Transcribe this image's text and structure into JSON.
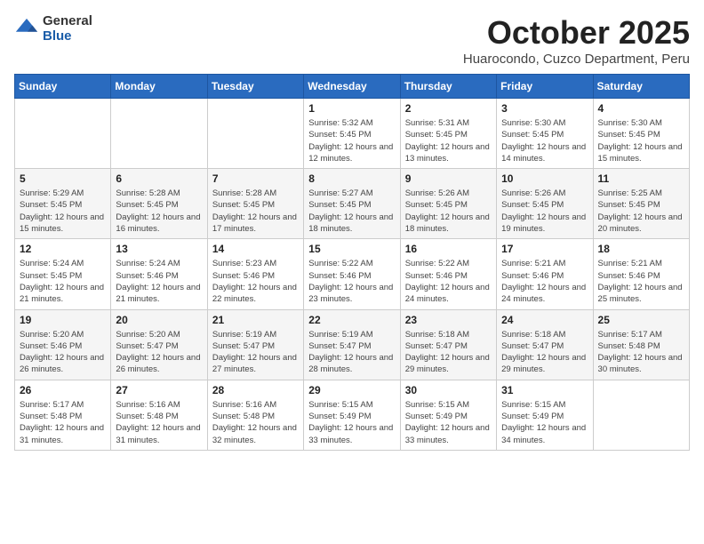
{
  "logo": {
    "general": "General",
    "blue": "Blue"
  },
  "title": "October 2025",
  "location": "Huarocondo, Cuzco Department, Peru",
  "days_of_week": [
    "Sunday",
    "Monday",
    "Tuesday",
    "Wednesday",
    "Thursday",
    "Friday",
    "Saturday"
  ],
  "weeks": [
    [
      {
        "day": "",
        "sunrise": "",
        "sunset": "",
        "daylight": ""
      },
      {
        "day": "",
        "sunrise": "",
        "sunset": "",
        "daylight": ""
      },
      {
        "day": "",
        "sunrise": "",
        "sunset": "",
        "daylight": ""
      },
      {
        "day": "1",
        "sunrise": "Sunrise: 5:32 AM",
        "sunset": "Sunset: 5:45 PM",
        "daylight": "Daylight: 12 hours and 12 minutes."
      },
      {
        "day": "2",
        "sunrise": "Sunrise: 5:31 AM",
        "sunset": "Sunset: 5:45 PM",
        "daylight": "Daylight: 12 hours and 13 minutes."
      },
      {
        "day": "3",
        "sunrise": "Sunrise: 5:30 AM",
        "sunset": "Sunset: 5:45 PM",
        "daylight": "Daylight: 12 hours and 14 minutes."
      },
      {
        "day": "4",
        "sunrise": "Sunrise: 5:30 AM",
        "sunset": "Sunset: 5:45 PM",
        "daylight": "Daylight: 12 hours and 15 minutes."
      }
    ],
    [
      {
        "day": "5",
        "sunrise": "Sunrise: 5:29 AM",
        "sunset": "Sunset: 5:45 PM",
        "daylight": "Daylight: 12 hours and 15 minutes."
      },
      {
        "day": "6",
        "sunrise": "Sunrise: 5:28 AM",
        "sunset": "Sunset: 5:45 PM",
        "daylight": "Daylight: 12 hours and 16 minutes."
      },
      {
        "day": "7",
        "sunrise": "Sunrise: 5:28 AM",
        "sunset": "Sunset: 5:45 PM",
        "daylight": "Daylight: 12 hours and 17 minutes."
      },
      {
        "day": "8",
        "sunrise": "Sunrise: 5:27 AM",
        "sunset": "Sunset: 5:45 PM",
        "daylight": "Daylight: 12 hours and 18 minutes."
      },
      {
        "day": "9",
        "sunrise": "Sunrise: 5:26 AM",
        "sunset": "Sunset: 5:45 PM",
        "daylight": "Daylight: 12 hours and 18 minutes."
      },
      {
        "day": "10",
        "sunrise": "Sunrise: 5:26 AM",
        "sunset": "Sunset: 5:45 PM",
        "daylight": "Daylight: 12 hours and 19 minutes."
      },
      {
        "day": "11",
        "sunrise": "Sunrise: 5:25 AM",
        "sunset": "Sunset: 5:45 PM",
        "daylight": "Daylight: 12 hours and 20 minutes."
      }
    ],
    [
      {
        "day": "12",
        "sunrise": "Sunrise: 5:24 AM",
        "sunset": "Sunset: 5:45 PM",
        "daylight": "Daylight: 12 hours and 21 minutes."
      },
      {
        "day": "13",
        "sunrise": "Sunrise: 5:24 AM",
        "sunset": "Sunset: 5:46 PM",
        "daylight": "Daylight: 12 hours and 21 minutes."
      },
      {
        "day": "14",
        "sunrise": "Sunrise: 5:23 AM",
        "sunset": "Sunset: 5:46 PM",
        "daylight": "Daylight: 12 hours and 22 minutes."
      },
      {
        "day": "15",
        "sunrise": "Sunrise: 5:22 AM",
        "sunset": "Sunset: 5:46 PM",
        "daylight": "Daylight: 12 hours and 23 minutes."
      },
      {
        "day": "16",
        "sunrise": "Sunrise: 5:22 AM",
        "sunset": "Sunset: 5:46 PM",
        "daylight": "Daylight: 12 hours and 24 minutes."
      },
      {
        "day": "17",
        "sunrise": "Sunrise: 5:21 AM",
        "sunset": "Sunset: 5:46 PM",
        "daylight": "Daylight: 12 hours and 24 minutes."
      },
      {
        "day": "18",
        "sunrise": "Sunrise: 5:21 AM",
        "sunset": "Sunset: 5:46 PM",
        "daylight": "Daylight: 12 hours and 25 minutes."
      }
    ],
    [
      {
        "day": "19",
        "sunrise": "Sunrise: 5:20 AM",
        "sunset": "Sunset: 5:46 PM",
        "daylight": "Daylight: 12 hours and 26 minutes."
      },
      {
        "day": "20",
        "sunrise": "Sunrise: 5:20 AM",
        "sunset": "Sunset: 5:47 PM",
        "daylight": "Daylight: 12 hours and 26 minutes."
      },
      {
        "day": "21",
        "sunrise": "Sunrise: 5:19 AM",
        "sunset": "Sunset: 5:47 PM",
        "daylight": "Daylight: 12 hours and 27 minutes."
      },
      {
        "day": "22",
        "sunrise": "Sunrise: 5:19 AM",
        "sunset": "Sunset: 5:47 PM",
        "daylight": "Daylight: 12 hours and 28 minutes."
      },
      {
        "day": "23",
        "sunrise": "Sunrise: 5:18 AM",
        "sunset": "Sunset: 5:47 PM",
        "daylight": "Daylight: 12 hours and 29 minutes."
      },
      {
        "day": "24",
        "sunrise": "Sunrise: 5:18 AM",
        "sunset": "Sunset: 5:47 PM",
        "daylight": "Daylight: 12 hours and 29 minutes."
      },
      {
        "day": "25",
        "sunrise": "Sunrise: 5:17 AM",
        "sunset": "Sunset: 5:48 PM",
        "daylight": "Daylight: 12 hours and 30 minutes."
      }
    ],
    [
      {
        "day": "26",
        "sunrise": "Sunrise: 5:17 AM",
        "sunset": "Sunset: 5:48 PM",
        "daylight": "Daylight: 12 hours and 31 minutes."
      },
      {
        "day": "27",
        "sunrise": "Sunrise: 5:16 AM",
        "sunset": "Sunset: 5:48 PM",
        "daylight": "Daylight: 12 hours and 31 minutes."
      },
      {
        "day": "28",
        "sunrise": "Sunrise: 5:16 AM",
        "sunset": "Sunset: 5:48 PM",
        "daylight": "Daylight: 12 hours and 32 minutes."
      },
      {
        "day": "29",
        "sunrise": "Sunrise: 5:15 AM",
        "sunset": "Sunset: 5:49 PM",
        "daylight": "Daylight: 12 hours and 33 minutes."
      },
      {
        "day": "30",
        "sunrise": "Sunrise: 5:15 AM",
        "sunset": "Sunset: 5:49 PM",
        "daylight": "Daylight: 12 hours and 33 minutes."
      },
      {
        "day": "31",
        "sunrise": "Sunrise: 5:15 AM",
        "sunset": "Sunset: 5:49 PM",
        "daylight": "Daylight: 12 hours and 34 minutes."
      },
      {
        "day": "",
        "sunrise": "",
        "sunset": "",
        "daylight": ""
      }
    ]
  ]
}
